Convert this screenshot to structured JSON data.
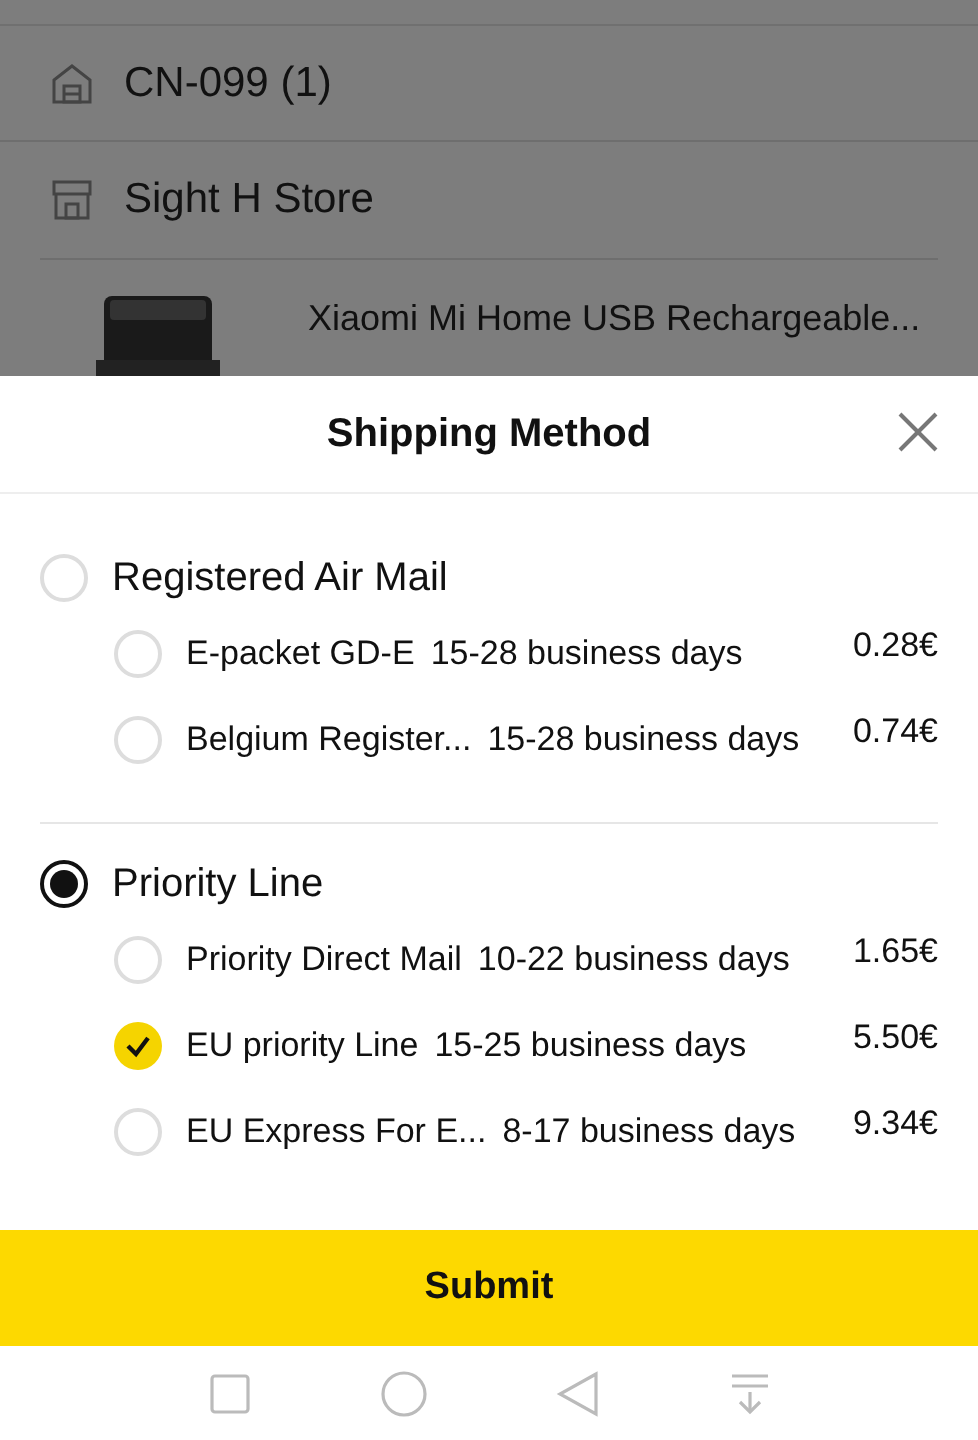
{
  "background": {
    "warehouse": "CN-099 (1)",
    "store": "Sight H Store",
    "product": {
      "title": "Xiaomi Mi Home USB Rechargeable...",
      "kind": "picture"
    }
  },
  "sheet": {
    "title": "Shipping Method",
    "groups": [
      {
        "name": "Registered Air Mail",
        "selected": false,
        "options": [
          {
            "name": "E-packet GD-E",
            "time": "15-28 business days",
            "price": "0.28€",
            "selected": false
          },
          {
            "name": "Belgium Register...",
            "time": "15-28 business days",
            "price": "0.74€",
            "selected": false
          }
        ]
      },
      {
        "name": "Priority Line",
        "selected": true,
        "options": [
          {
            "name": "Priority Direct Mail",
            "time": "10-22 business days",
            "price": "1.65€",
            "selected": false
          },
          {
            "name": "EU priority Line",
            "time": "15-25 business days",
            "price": "5.50€",
            "selected": true
          },
          {
            "name": "EU Express For E...",
            "time": "8-17 business days",
            "price": "9.34€",
            "selected": false
          }
        ]
      }
    ],
    "submit": "Submit"
  }
}
